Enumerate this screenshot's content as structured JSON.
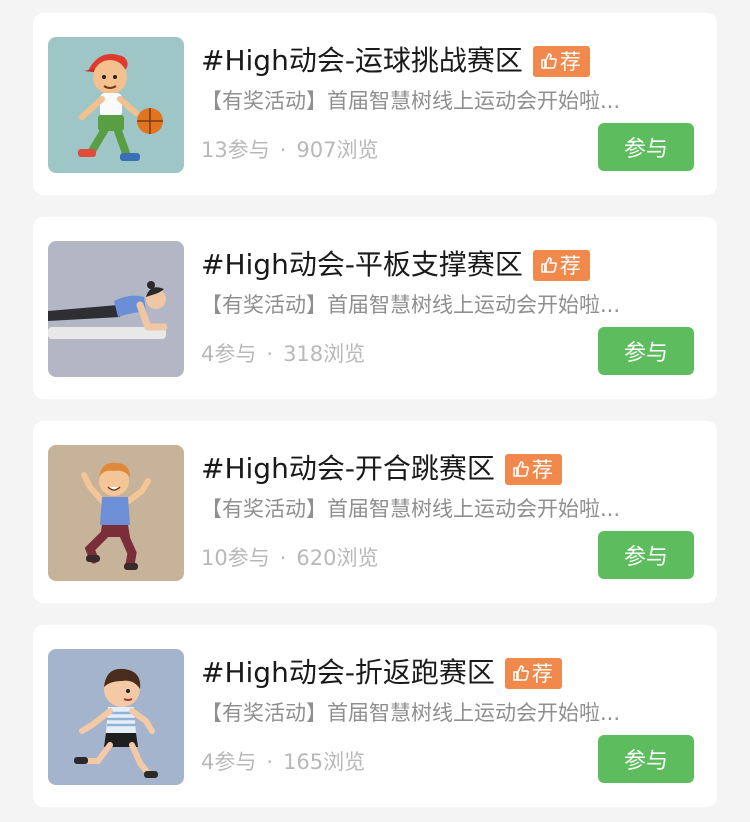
{
  "items": [
    {
      "title": "#High动会-运球挑战赛区",
      "badge": "荐",
      "description": "【有奖活动】首届智慧树线上运动会开始啦...",
      "participants": "13参与",
      "separator": "·",
      "views": "907浏览",
      "button": "参与",
      "image": "basketball-boy-illustration"
    },
    {
      "title": "#High动会-平板支撑赛区",
      "badge": "荐",
      "description": "【有奖活动】首届智慧树线上运动会开始啦...",
      "participants": "4参与",
      "separator": "·",
      "views": "318浏览",
      "button": "参与",
      "image": "plank-woman-illustration"
    },
    {
      "title": "#High动会-开合跳赛区",
      "badge": "荐",
      "description": "【有奖活动】首届智慧树线上运动会开始啦...",
      "participants": "10参与",
      "separator": "·",
      "views": "620浏览",
      "button": "参与",
      "image": "jumping-jack-boy-illustration"
    },
    {
      "title": "#High动会-折返跑赛区",
      "badge": "荐",
      "description": "【有奖活动】首届智慧树线上运动会开始啦...",
      "participants": "4参与",
      "separator": "·",
      "views": "165浏览",
      "button": "参与",
      "image": "running-boy-illustration"
    }
  ],
  "colors": {
    "badge": "#f0894b",
    "button": "#5dbd5e",
    "title": "#1a1a1a",
    "description": "#8f8f8f",
    "stats": "#b8b8b8"
  }
}
